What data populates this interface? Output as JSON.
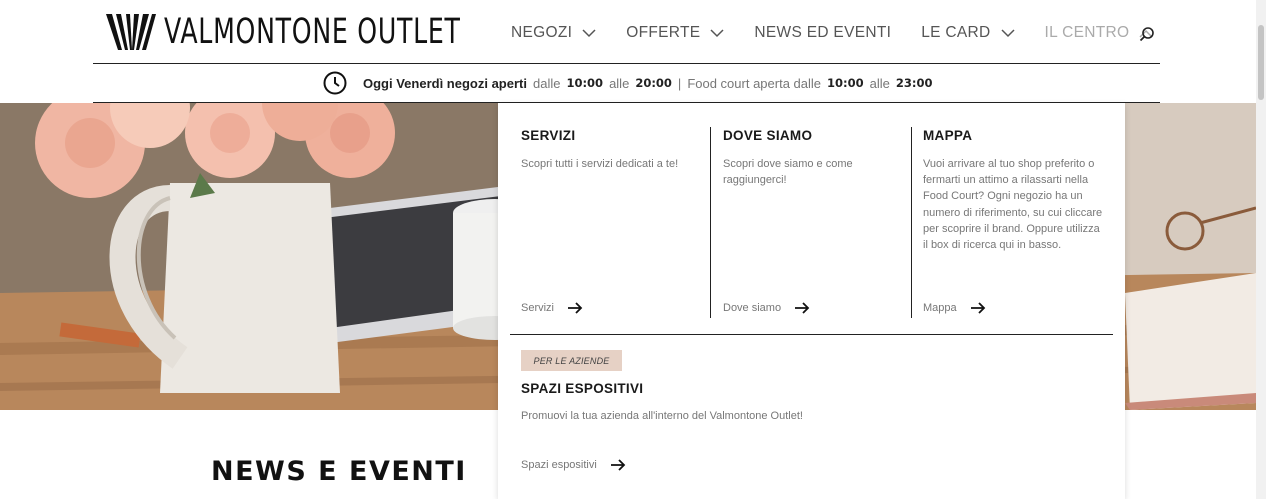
{
  "header": {
    "logo_text": "VALMONTONE OUTLET",
    "nav": [
      {
        "label": "NEGOZI",
        "has_dropdown": true,
        "expanded": false
      },
      {
        "label": "OFFERTE",
        "has_dropdown": true,
        "expanded": false
      },
      {
        "label": "NEWS ED EVENTI",
        "has_dropdown": false,
        "expanded": false
      },
      {
        "label": "LE CARD",
        "has_dropdown": true,
        "expanded": false
      },
      {
        "label": "IL CENTRO",
        "has_dropdown": true,
        "expanded": true
      }
    ],
    "search_icon": "search-icon"
  },
  "hours": {
    "open_text": "Oggi Venerdì negozi aperti",
    "from1": "dalle",
    "time1": "10:00",
    "to1": "alle",
    "time2": "20:00",
    "separator": "|",
    "food_text": "Food court aperta dalle",
    "time3": "10:00",
    "to2": "alle",
    "time4": "23:00"
  },
  "dropdown": {
    "columns": [
      {
        "title": "SERVIZI",
        "text": "Scopri tutti i servizi dedicati a te!",
        "link": "Servizi"
      },
      {
        "title": "DOVE SIAMO",
        "text": "Scopri dove siamo e come raggiungerci!",
        "link": "Dove siamo"
      },
      {
        "title": "MAPPA",
        "text": "Vuoi arrivare al tuo shop preferito o fermarti un attimo a rilassarti nella Food Court? Ogni negozio ha un numero di riferimento, su cui cliccare per scoprire il brand. Oppure utilizza il box di ricerca qui in basso.",
        "link": "Mappa"
      }
    ],
    "badge": "PER LE AZIENDE",
    "bottom_title": "SPAZI ESPOSITIVI",
    "bottom_text": "Promuovi la tua azienda all'interno del Valmontone Outlet!",
    "bottom_link": "Spazi espositivi"
  },
  "main": {
    "news_title": "NEWS E EVENTI"
  },
  "colors": {
    "badge_bg": "#e6d1c5",
    "text_dark": "#1a1a1a",
    "text_muted": "#777777",
    "nav_active": "#aaaaaa"
  }
}
